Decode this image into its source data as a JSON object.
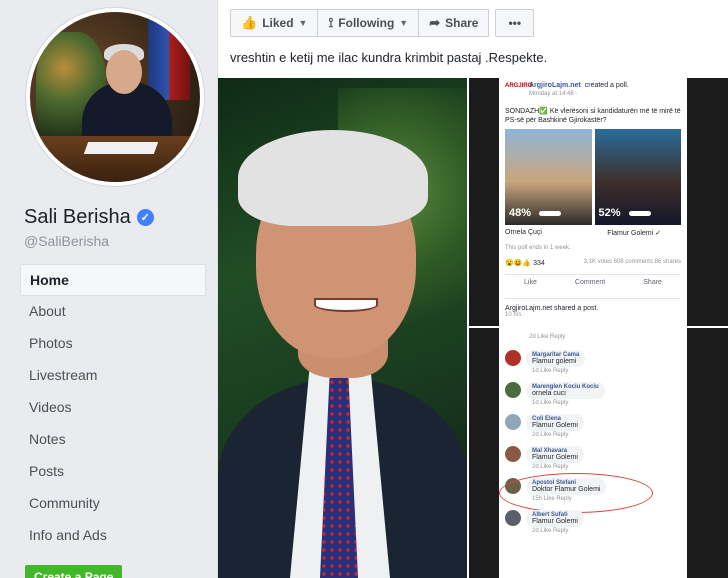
{
  "sidebar": {
    "name": "Sali Berisha",
    "handle": "@SaliBerisha",
    "nav": [
      "Home",
      "About",
      "Photos",
      "Livestream",
      "Videos",
      "Notes",
      "Posts",
      "Community",
      "Info and Ads"
    ],
    "create_page": "Create a Page"
  },
  "post": {
    "actions": {
      "liked": "Liked",
      "following": "Following",
      "share": "Share",
      "more": "•••"
    },
    "caption": "vreshtin e ketij me ilac kundra krimbit pastaj .Respekte.",
    "poll_card": {
      "source": "ArgjiroLajm.net",
      "logo": "ARGJIRO",
      "created": "created a poll.",
      "time": "Monday at 14:48 · ",
      "question": "SONDAZH✅ Kë vlerësoni si kandidaturën më të mirë të PS-së për Bashkinë Gjirokastër?",
      "option_a_pct": "48%",
      "option_b_pct": "52%",
      "option_a_name": "Ornela Çuçi",
      "option_b_name": "Flamur Golemi ✓",
      "ends": "This poll ends in 1 week.",
      "reactions": "😮😃👍 334",
      "votes": "3,1K votes   608 comments   86 shares",
      "like": "Like",
      "comment": "Comment",
      "share": "Share",
      "shared_by": "ArgjiroLajm.net shared a post.",
      "shared_time": "10 hrs · "
    },
    "comments": [
      {
        "name": "Margaritar Cama",
        "text": "Flamur golemi",
        "meta": "1d   Like   Reply",
        "color": "#b0302a"
      },
      {
        "name": "Marenglen Kociu Kociu",
        "text": "ornela cuci",
        "meta": "1d   Like   Reply",
        "color": "#4a6b3c"
      },
      {
        "name": "Coli Elena",
        "text": "Flamur Golemi",
        "meta": "2d   Like   Reply",
        "color": "#8fa7b8"
      },
      {
        "name": "Mal Xhavara",
        "text": "Flamur Golemi",
        "meta": "2d   Like   Reply",
        "color": "#8a5a44"
      },
      {
        "name": "Apostol Stefani",
        "text": "Doktor Flamur Golemi",
        "meta": "15h   Like   Reply",
        "color": "#6d6049"
      },
      {
        "name": "Albert Sufati",
        "text": "Flamur Golemi",
        "meta": "2d   Like   Reply",
        "color": "#5a5f6b"
      }
    ],
    "top_meta": "2d   Like   Reply"
  }
}
